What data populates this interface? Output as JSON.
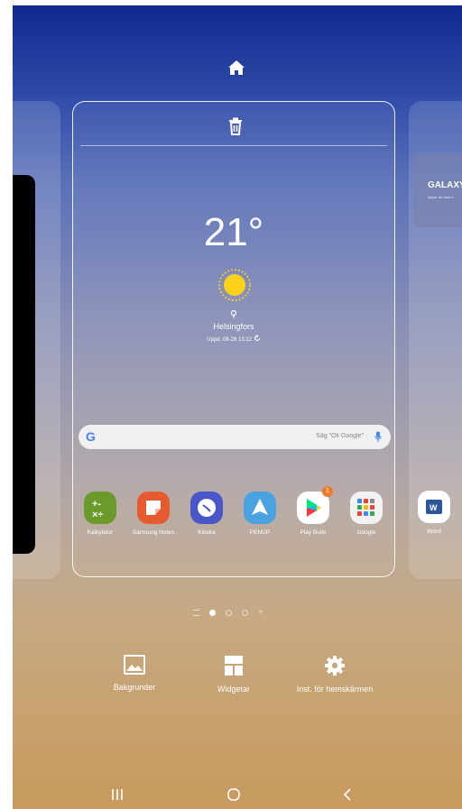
{
  "weather": {
    "temperature": "21°",
    "city": "Helsingfors",
    "updated": "Uppd. 08-28 13:12"
  },
  "search": {
    "logo": "G",
    "hint": "Säg \"Ok Google\""
  },
  "apps": [
    {
      "label": "Kalkylator",
      "color": "#6a9a2a"
    },
    {
      "label": "Samsung Notes",
      "color": "#e55a2e"
    },
    {
      "label": "Klocka",
      "color": "#4a55c8"
    },
    {
      "label": "PENUP",
      "color": "#4aa3e0"
    },
    {
      "label": "Play Butik",
      "color": "#ffffff",
      "badge": "1"
    },
    {
      "label": "Google",
      "color": "#f2f2f2"
    }
  ],
  "right_panel": {
    "card_title": "GALAXY",
    "card_subtitle": "Appar du bara e",
    "dock_app": "Word"
  },
  "bottom_options": {
    "wallpapers": "Bakgrunder",
    "widgets": "Widgetar",
    "settings": "Inst. för hemskärmen"
  },
  "icons": [
    "home-icon",
    "trash-icon",
    "sun-icon",
    "location-pin-icon",
    "refresh-icon",
    "mic-icon",
    "image-icon",
    "widgets-icon",
    "gear-icon",
    "recents-icon",
    "home-button-icon",
    "back-icon"
  ]
}
